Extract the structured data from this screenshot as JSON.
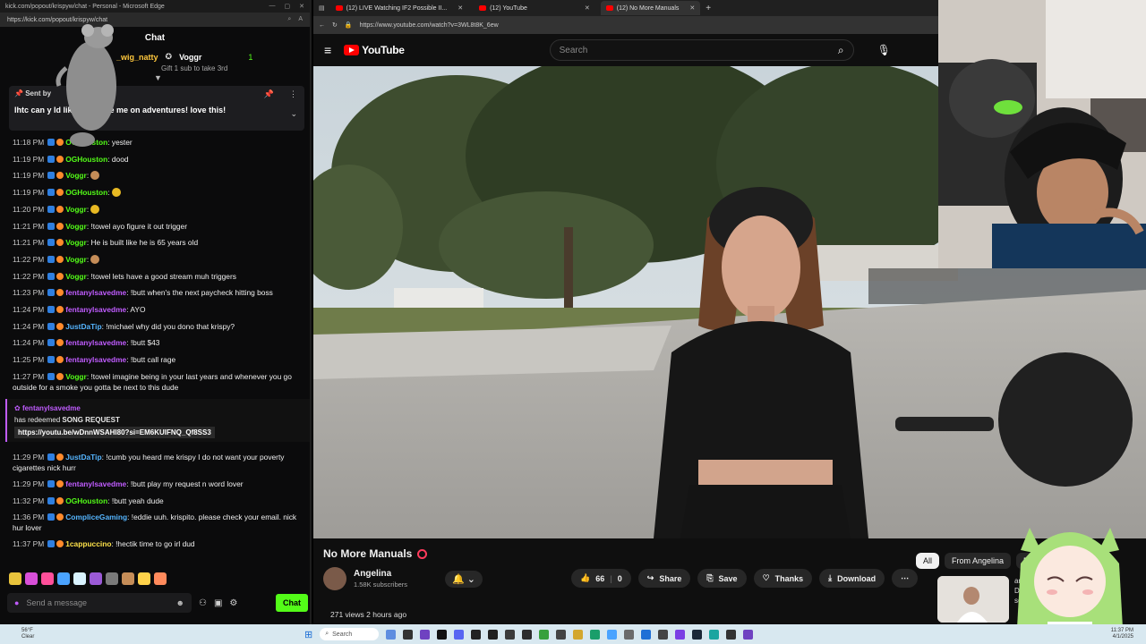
{
  "chat_window": {
    "title": "kick.com/popout/krispyw/chat - Personal - Microsoft Edge",
    "url": "https://kick.com/popout/krispyw/chat",
    "header": "Chat",
    "gift": {
      "user": "_wig_natty",
      "gifter": "Voggr",
      "count": "1",
      "subtext": "Gift 1 sub to take 3rd"
    },
    "pinned": {
      "by": "Sent by",
      "text": "lhtc can y                       ld like this! take me on adventures! love this!"
    },
    "messages": [
      {
        "time": "11:18 PM",
        "user": "OGHouston",
        "color": "green",
        "text": "yester"
      },
      {
        "time": "11:19 PM",
        "user": "OGHouston",
        "color": "green",
        "text": "dood"
      },
      {
        "time": "11:19 PM",
        "user": "Voggr",
        "color": "green",
        "text": "",
        "emote": "tan"
      },
      {
        "time": "11:19 PM",
        "user": "OGHouston",
        "color": "green",
        "text": "",
        "emote": "yellow"
      },
      {
        "time": "11:20 PM",
        "user": "Voggr",
        "color": "green",
        "text": "",
        "emote": "yellow"
      },
      {
        "time": "11:21 PM",
        "user": "Voggr",
        "color": "green",
        "text": "!towel ayo figure it out trigger"
      },
      {
        "time": "11:21 PM",
        "user": "Voggr",
        "color": "green",
        "text": "He is built like he is 65 years old"
      },
      {
        "time": "11:22 PM",
        "user": "Voggr",
        "color": "green",
        "text": "",
        "emote": "tan"
      },
      {
        "time": "11:22 PM",
        "user": "Voggr",
        "color": "green",
        "text": "!towel lets have a good stream muh triggers"
      },
      {
        "time": "11:23 PM",
        "user": "fentanylsavedme",
        "color": "pink",
        "text": "!butt when's the next paycheck hitting boss"
      },
      {
        "time": "11:24 PM",
        "user": "fentanylsavedme",
        "color": "pink",
        "text": "AYO"
      },
      {
        "time": "11:24 PM",
        "user": "JustDaTip",
        "color": "blue",
        "text": "!michael why did you dono that krispy?"
      },
      {
        "time": "11:24 PM",
        "user": "fentanylsavedme",
        "color": "pink",
        "text": "!butt $43"
      },
      {
        "time": "11:25 PM",
        "user": "fentanylsavedme",
        "color": "pink",
        "text": "!butt call rage"
      },
      {
        "time": "11:27 PM",
        "user": "Voggr",
        "color": "green",
        "text": "!towel imagine being in your last years and whenever you go outside for a smoke you gotta be next to this dude",
        "wrap": true
      }
    ],
    "redeem": {
      "user": "fentanylsavedme",
      "prefix": "has redeemed",
      "reward": "SONG REQUEST",
      "link": "https://youtu.be/wDnnWSAHI80?si=EM6KUIFNQ_Qf8SS3"
    },
    "messages2": [
      {
        "time": "11:29 PM",
        "user": "JustDaTip",
        "color": "blue",
        "text": "!cumb you heard me krispy I do not want your poverty cigarettes nick hurr",
        "wrap": true
      },
      {
        "time": "11:29 PM",
        "user": "fentanylsavedme",
        "color": "pink",
        "text": "!butt play my request n word lover"
      },
      {
        "time": "11:32 PM",
        "user": "OGHouston",
        "color": "green",
        "text": "!butt yeah dude"
      },
      {
        "time": "11:36 PM",
        "user": "CompliceGaming",
        "color": "blue",
        "text": "!eddie uuh. krispito. please check your email. nick hur lover",
        "wrap": true
      },
      {
        "time": "11:37 PM",
        "user": "1cappuccino",
        "color": "yellow",
        "text": "!hectik time to go irl dud"
      }
    ],
    "send_placeholder": "Send a message",
    "chat_button": "Chat"
  },
  "browser": {
    "tabs": [
      {
        "label": "(12) LIVE Watching IF2 Possible II..."
      },
      {
        "label": "(12) YouTube"
      },
      {
        "label": "(12) No More Manuals"
      }
    ],
    "url": "https://www.youtube.com/watch?v=3WL8t8K_6ew",
    "logo": "YouTube",
    "search_placeholder": "Search"
  },
  "video_info": {
    "title": "No More Manuals",
    "channel": "Angelina",
    "subscribers": "1.58K subscribers",
    "likes": "66",
    "dislikes": "0",
    "share": "Share",
    "save": "Save",
    "thanks": "Thanks",
    "download": "Download",
    "views": "271 views  2 hours ago",
    "filters": [
      "All",
      "From Angelina",
      "R"
    ],
    "rec_text": "an\nDre\nsera"
  },
  "taskbar": {
    "weather": "56°F\nClear",
    "search": "Search",
    "clock": "11:37 PM\n4/1/2025"
  },
  "colors": {
    "kick_green": "#53fc18",
    "yt_red": "#ff0000",
    "user_pink": "#c05cff",
    "user_blue": "#55b5ff"
  }
}
